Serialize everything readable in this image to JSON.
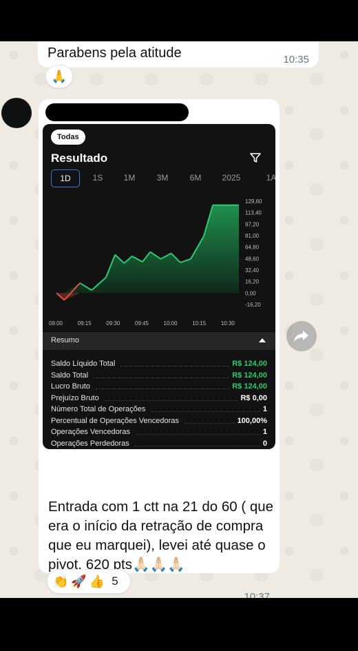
{
  "messages": {
    "top": {
      "text": "Parabens pela atitude",
      "time": "10:35",
      "reaction": "🙏"
    },
    "main": {
      "text": "Entrada com 1 ctt na 21 do 60 ( que era o início da retração de compra que eu marquei), levei até quase o pivot, 620 pts🙏🏻🙏🏻🙏🏻",
      "time": "10:37",
      "reactions": [
        "👏",
        "🚀",
        "👍"
      ],
      "reaction_count": "5"
    }
  },
  "screenshot": {
    "filter_pill": "Todas",
    "title": "Resultado",
    "periods": [
      {
        "label": "1D",
        "active": true
      },
      {
        "label": "1S",
        "active": false
      },
      {
        "label": "1M",
        "active": false
      },
      {
        "label": "3M",
        "active": false
      },
      {
        "label": "6M",
        "active": false
      },
      {
        "label": "2025",
        "active": false
      },
      {
        "label": "1A",
        "active": false
      }
    ],
    "resumo_label": "Resumo",
    "summary": [
      {
        "label": "Saldo Líquido Total",
        "value": "R$ 124,00",
        "color": "green"
      },
      {
        "label": "Saldo Total",
        "value": "R$ 124,00",
        "color": "green"
      },
      {
        "label": "Lucro Bruto",
        "value": "R$ 124,00",
        "color": "green"
      },
      {
        "label": "Prejuízo Bruto",
        "value": "R$ 0,00",
        "color": "white"
      },
      {
        "label": "Número Total de Operações",
        "value": "1",
        "color": "white"
      },
      {
        "label": "Percentual de Operações Vencedoras",
        "value": "100,00%",
        "color": "white"
      },
      {
        "label": "Operações Vencedoras",
        "value": "1",
        "color": "white"
      },
      {
        "label": "Operações Perdedoras",
        "value": "0",
        "color": "white"
      }
    ]
  },
  "chart_data": {
    "type": "area",
    "x_ticks": [
      "09:00",
      "09:15",
      "09:30",
      "09:45",
      "10:00",
      "10:15",
      "10:30"
    ],
    "y_ticks": [
      "129,60",
      "113,40",
      "97,20",
      "81,00",
      "64,80",
      "48,60",
      "32,40",
      "16,20",
      "0,00",
      "-16,20"
    ],
    "ylim": [
      -16.2,
      129.6
    ],
    "x_minutes": [
      0,
      6,
      18,
      27,
      38,
      45,
      52,
      58,
      66,
      72,
      80,
      88,
      95,
      103,
      113,
      120,
      130,
      140
    ],
    "y": [
      0,
      -10,
      14,
      4,
      22,
      54,
      42,
      52,
      44,
      58,
      48,
      56,
      43,
      48,
      80,
      124,
      124,
      124
    ],
    "colors": {
      "positive": "#2ecc71",
      "negative": "#e74c3c",
      "fill_top": "#1f8f4e",
      "fill_bottom": "#0f2a1a"
    }
  }
}
